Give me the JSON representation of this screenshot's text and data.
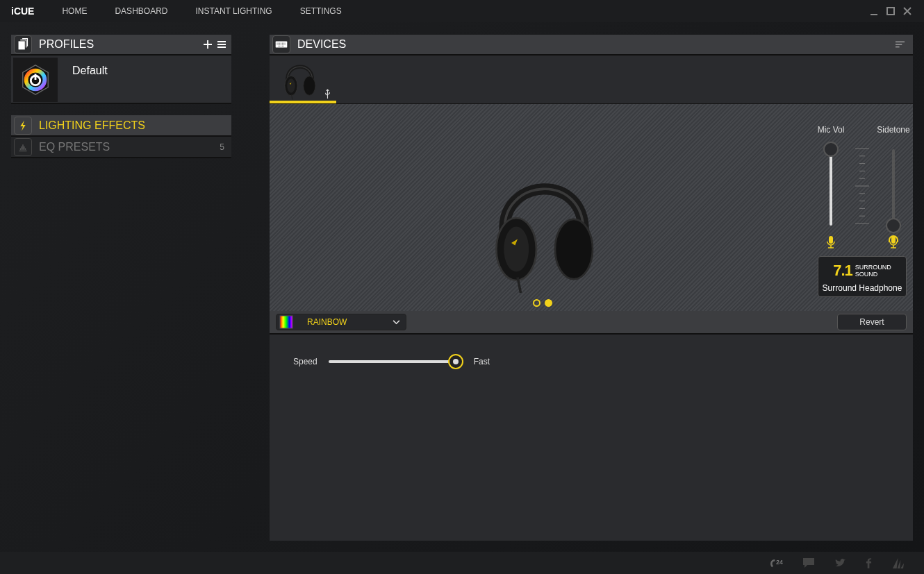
{
  "nav": {
    "brand": "iCUE",
    "items": [
      {
        "label": "HOME",
        "selected": false
      },
      {
        "label": "DASHBOARD",
        "selected": false
      },
      {
        "label": "INSTANT LIGHTING",
        "selected": false
      },
      {
        "label": "SETTINGS",
        "selected": false
      }
    ]
  },
  "profiles": {
    "title": "PROFILES",
    "items": [
      {
        "name": "Default",
        "selected": true
      }
    ]
  },
  "sections": [
    {
      "label": "LIGHTING EFFECTS",
      "selected": true
    },
    {
      "label": "EQ PRESETS",
      "selected": false,
      "count": "5"
    }
  ],
  "devices": {
    "title": "DEVICES",
    "tabs": [
      {
        "selected": true
      }
    ]
  },
  "carousel_dots": [
    {
      "selected": false
    },
    {
      "selected": true
    }
  ],
  "sliders": [
    {
      "label": "Mic Vol",
      "level": 1
    },
    {
      "label": "Sidetone",
      "level": 0
    }
  ],
  "surround": {
    "number": "7.1",
    "line_1": "SURROUND",
    "line_2": "SOUND",
    "mode": "Surround Headphone"
  },
  "effect": {
    "name": "RAINBOW",
    "revert": "Revert",
    "speed_label": "Speed",
    "speed_end": "Fast",
    "level": 1
  },
  "footer": {
    "support_badge": "24"
  }
}
